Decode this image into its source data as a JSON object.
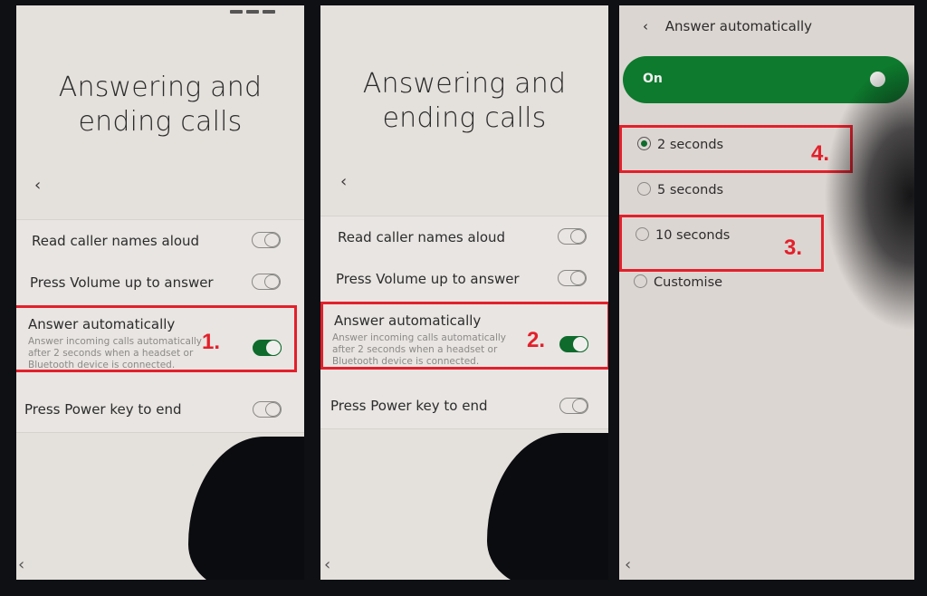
{
  "panels": [
    {
      "title_line1": "Answering and",
      "title_line2": "ending calls",
      "back_icon": "‹",
      "settings": [
        {
          "label": "Read caller names aloud",
          "toggle": "off"
        },
        {
          "label": "Press Volume up to answer",
          "toggle": "off"
        },
        {
          "label": "Answer automatically",
          "description": "Answer incoming calls automatically after 2 seconds when a headset or Bluetooth device is connected.",
          "toggle": "on"
        },
        {
          "label": "Press Power key to end",
          "toggle": "off"
        }
      ],
      "step_label": "1.",
      "nav_back_icon": "‹"
    },
    {
      "title_line1": "Answering and",
      "title_line2": "ending calls",
      "back_icon": "‹",
      "settings": [
        {
          "label": "Read caller names aloud",
          "toggle": "off"
        },
        {
          "label": "Press Volume up to answer",
          "toggle": "off"
        },
        {
          "label": "Answer automatically",
          "description": "Answer incoming calls automatically after 2 seconds when a headset or Bluetooth device is connected.",
          "toggle": "on"
        },
        {
          "label": "Press Power key to end",
          "toggle": "off"
        }
      ],
      "step_label": "2.",
      "nav_back_icon": "‹"
    },
    {
      "header_title": "Answer automatically",
      "back_icon": "‹",
      "master_switch_label": "On",
      "master_switch_state": "on",
      "options": [
        {
          "label": "2 seconds",
          "selected": true
        },
        {
          "label": "5 seconds",
          "selected": false
        },
        {
          "label": "10 seconds",
          "selected": false
        },
        {
          "label": "Customise",
          "selected": false
        }
      ],
      "step_labels": [
        "4.",
        "3."
      ],
      "nav_back_icon": "‹"
    }
  ],
  "colors": {
    "accent_green": "#0e6b2c",
    "annotation_red": "#e3202b"
  }
}
